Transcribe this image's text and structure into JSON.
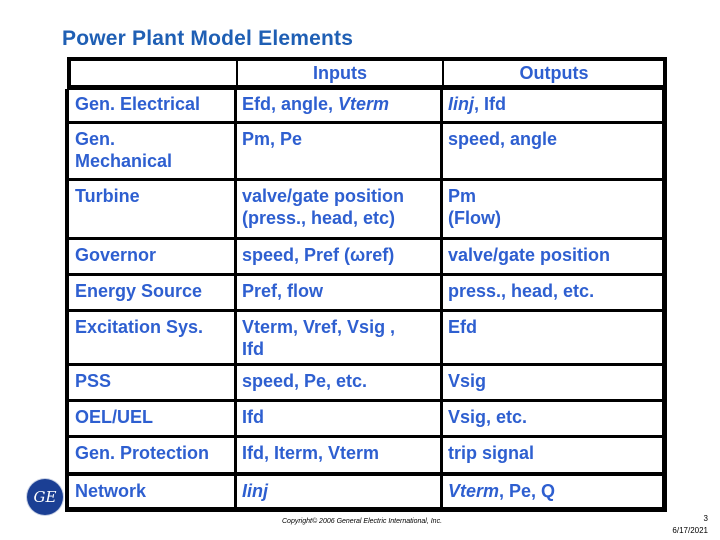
{
  "title": "Power Plant Model Elements",
  "table": {
    "headers": [
      "",
      "Inputs",
      "Outputs"
    ],
    "rows": [
      {
        "element": "Gen. Electrical",
        "inputs": "Efd, angle, Vterm",
        "outputs": "Iinj, Ifd"
      },
      {
        "element": "Gen.\nMechanical",
        "inputs": "Pm, Pe",
        "outputs": "speed, angle"
      },
      {
        "element": "Turbine",
        "inputs": "valve/gate position\n(press., head, etc)",
        "outputs": "Pm\n(Flow)"
      },
      {
        "element": "Governor",
        "inputs": "speed, Pref (ωref)",
        "outputs": "valve/gate position"
      },
      {
        "element": "Energy Source",
        "inputs": "Pref, flow",
        "outputs": "press., head, etc."
      },
      {
        "element": "Excitation Sys.",
        "inputs": "Vterm, Vref, Vsig ,\nIfd",
        "outputs": "Efd"
      },
      {
        "element": "PSS",
        "inputs": "speed, Pe, etc.",
        "outputs": "Vsig"
      },
      {
        "element": "OEL/UEL",
        "inputs": "Ifd",
        "outputs": "Vsig, etc."
      },
      {
        "element": "Gen. Protection",
        "inputs": "Ifd, Iterm, Vterm",
        "outputs": "trip signal"
      },
      {
        "element": "Network",
        "inputs": "Iinj",
        "outputs": "Vterm, Pe, Q"
      }
    ]
  },
  "logo": {
    "icon": "ge-logo-icon",
    "text": "GE"
  },
  "footer": {
    "copyright": "Copyright© 2006 General Electric International, Inc.",
    "page_number": "3",
    "date": "6/17/2021"
  },
  "colors": {
    "title": "#1f5fb4",
    "text": "#2e5fd0",
    "border": "#000000"
  }
}
